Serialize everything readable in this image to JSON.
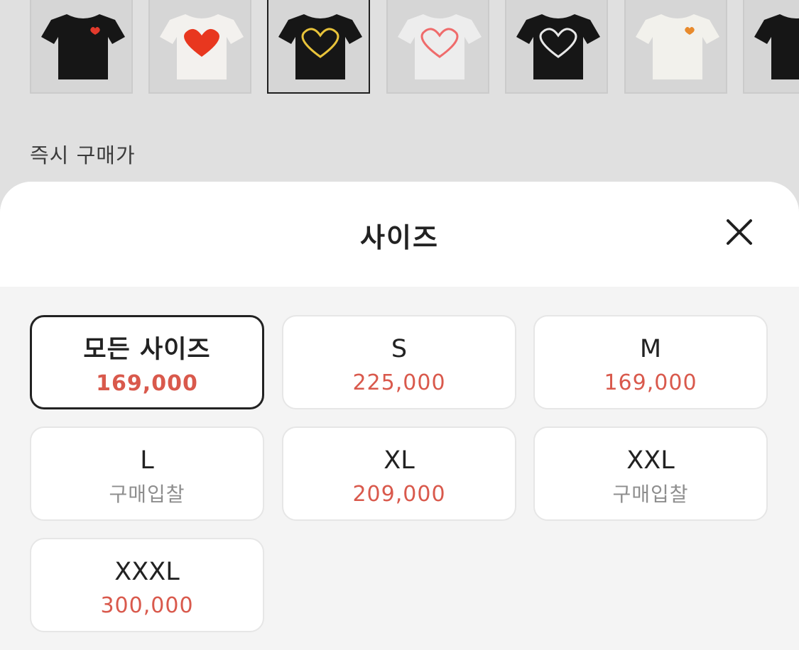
{
  "background": {
    "thumbnails": [
      {
        "name": "black-tee-small-heart",
        "shirt": "#161616",
        "print": "small-heart",
        "print_color": "#e23a2c"
      },
      {
        "name": "white-tee-red-heart",
        "shirt": "#f3f1ee",
        "print": "heart",
        "print_color": "#e8371f"
      },
      {
        "name": "black-tee-yellow-heart",
        "shirt": "#161616",
        "print": "heart-outline",
        "print_color": "#e8c33a"
      },
      {
        "name": "white-tee-pink-heart",
        "shirt": "#ededed",
        "print": "heart-outline",
        "print_color": "#ef6b6b"
      },
      {
        "name": "black-tee-white-heart",
        "shirt": "#161616",
        "print": "heart-outline",
        "print_color": "#e8e8e8"
      },
      {
        "name": "white-tee-small-heart",
        "shirt": "#f2f1ec",
        "print": "small-heart",
        "print_color": "#e88a2c"
      },
      {
        "name": "black-tee-partial",
        "shirt": "#161616",
        "print": "none",
        "print_color": "#161616"
      }
    ],
    "selected_thumbnail_index": 2,
    "instant_buy_label": "즉시 구매가"
  },
  "sheet": {
    "title": "사이즈",
    "close_icon": "close-icon",
    "options": [
      {
        "size": "모든 사이즈",
        "price": "169,000",
        "selected": true,
        "status": "price"
      },
      {
        "size": "S",
        "price": "225,000",
        "selected": false,
        "status": "price"
      },
      {
        "size": "M",
        "price": "169,000",
        "selected": false,
        "status": "price"
      },
      {
        "size": "L",
        "price": "구매입찰",
        "selected": false,
        "status": "bid"
      },
      {
        "size": "XL",
        "price": "209,000",
        "selected": false,
        "status": "price"
      },
      {
        "size": "XXL",
        "price": "구매입찰",
        "selected": false,
        "status": "bid"
      },
      {
        "size": "XXXL",
        "price": "300,000",
        "selected": false,
        "status": "price"
      }
    ]
  },
  "colors": {
    "price_accent": "#d9594c",
    "bid_text": "#8e8e8e",
    "selected_border": "#222222"
  }
}
